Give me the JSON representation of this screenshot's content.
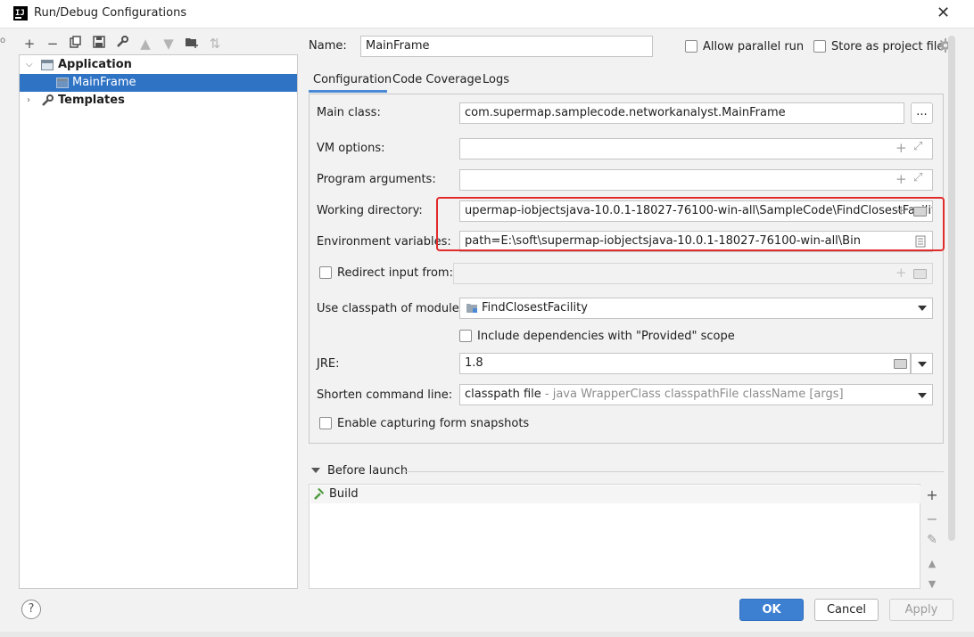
{
  "window": {
    "title": "Run/Debug Configurations",
    "app_logo_text": "IJ"
  },
  "tree": {
    "items": [
      {
        "label": "Application",
        "bold": true,
        "expanded": true
      },
      {
        "label": "MainFrame",
        "selected": true
      },
      {
        "label": "Templates",
        "bold": true,
        "expanded": false
      }
    ]
  },
  "name": {
    "label": "Name:",
    "value": "MainFrame"
  },
  "options": {
    "allow_parallel": "Allow parallel run",
    "store_as_project": "Store as project file"
  },
  "tabs": [
    {
      "label": "Configuration",
      "active": true
    },
    {
      "label": "Code Coverage"
    },
    {
      "label": "Logs"
    }
  ],
  "config": {
    "main_class": {
      "label": "Main class:",
      "value": "com.supermap.samplecode.networkanalyst.MainFrame",
      "button": "..."
    },
    "vm_options": {
      "label": "VM options:",
      "value": ""
    },
    "program_arguments": {
      "label": "Program arguments:",
      "value": ""
    },
    "working_directory": {
      "label": "Working directory:",
      "value": "upermap-iobjectsjava-10.0.1-18027-76100-win-all\\SampleCode\\FindClosestFacility"
    },
    "environment_variables": {
      "label": "Environment variables:",
      "value": "path=E:\\soft\\supermap-iobjectsjava-10.0.1-18027-76100-win-all\\Bin"
    },
    "redirect_input": {
      "label": "Redirect input from:"
    },
    "classpath_module": {
      "label": "Use classpath of module:",
      "value": "FindClosestFacility"
    },
    "include_provided": "Include dependencies with \"Provided\" scope",
    "jre": {
      "label": "JRE:",
      "value": "1.8"
    },
    "shorten_command": {
      "label": "Shorten command line:",
      "value": "classpath file",
      "hint": " - java WrapperClass classpathFile className [args]"
    },
    "enable_capturing": "Enable capturing form snapshots"
  },
  "before_launch": {
    "header": "Before launch",
    "items": [
      {
        "label": "Build"
      }
    ]
  },
  "footer": {
    "help": "?",
    "ok": "OK",
    "cancel": "Cancel",
    "apply": "Apply"
  },
  "colors": {
    "accent": "#3d7fd1",
    "selection": "#2f73c5",
    "highlight": "#e22b2b"
  }
}
